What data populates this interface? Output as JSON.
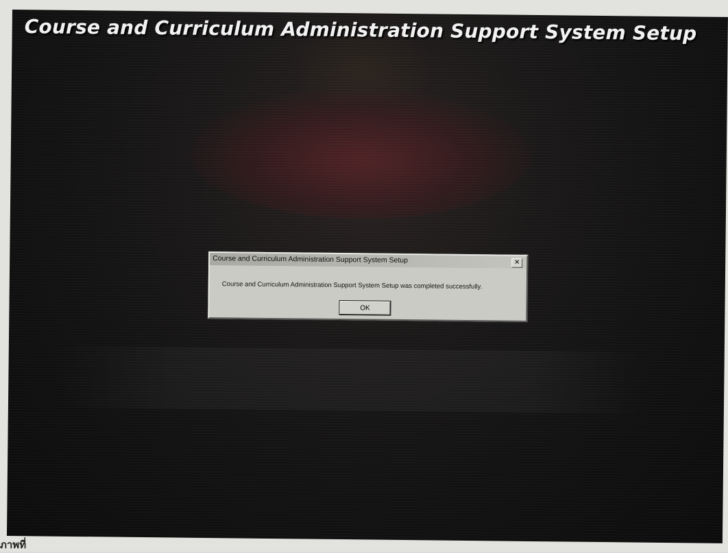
{
  "setup_screen": {
    "title": "Course and Curriculum Administration Support System Setup"
  },
  "dialog": {
    "title": "Course and Curriculum Administration Support System Setup",
    "close_glyph": "✕",
    "message": "Course and Curriculum Administration Support System Setup was completed successfully.",
    "ok_label": "OK"
  },
  "caption_fragment": "ภาพที่ "
}
